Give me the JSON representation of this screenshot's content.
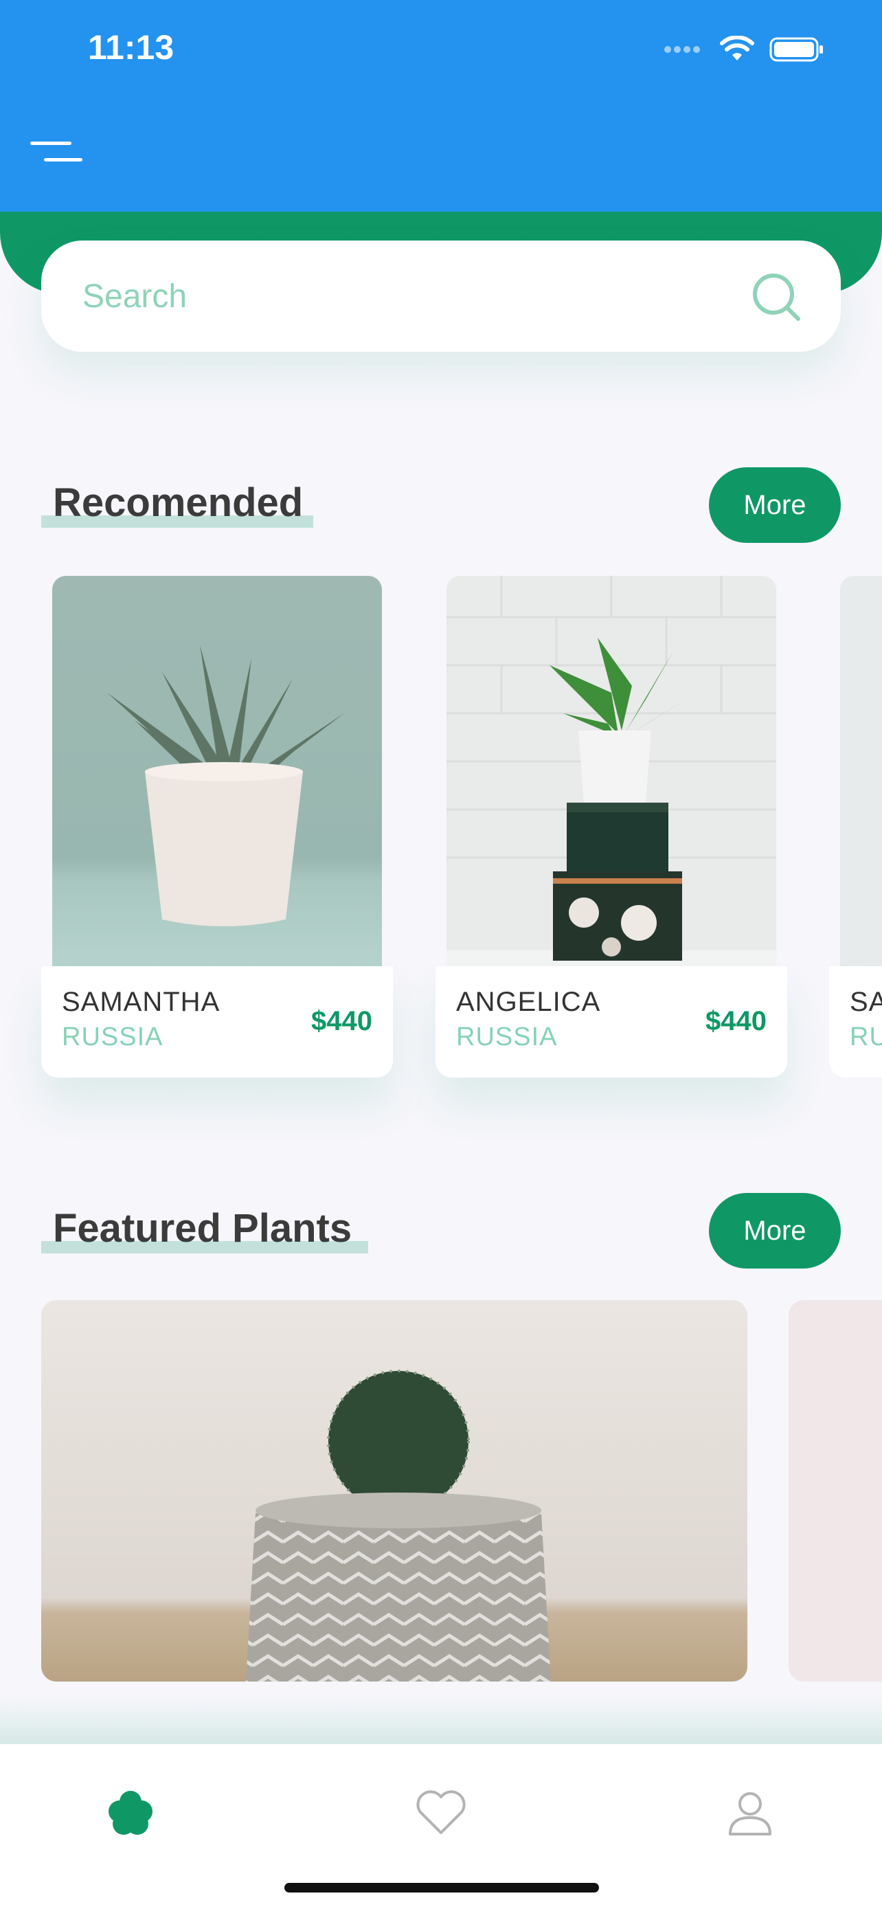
{
  "status_bar": {
    "time": "11:13"
  },
  "search": {
    "placeholder": "Search"
  },
  "sections": {
    "recommended": {
      "title": "Recomended",
      "more_label": "More"
    },
    "featured": {
      "title": "Featured Plants",
      "more_label": "More"
    }
  },
  "recommended_items": [
    {
      "name": "SAMANTHA",
      "country": "RUSSIA",
      "price": "$440"
    },
    {
      "name": "ANGELICA",
      "country": "RUSSIA",
      "price": "$440"
    },
    {
      "name": "SA",
      "country": "RU",
      "price": ""
    }
  ],
  "colors": {
    "app_bar": "#2393ef",
    "accent_green": "#0f9866",
    "muted_green": "#86d2b6",
    "background": "#f6f6fb"
  },
  "icons": {
    "menu": "menu-icon",
    "search": "search-icon",
    "nav_home": "flower-icon",
    "nav_favorites": "heart-icon",
    "nav_profile": "user-icon"
  }
}
